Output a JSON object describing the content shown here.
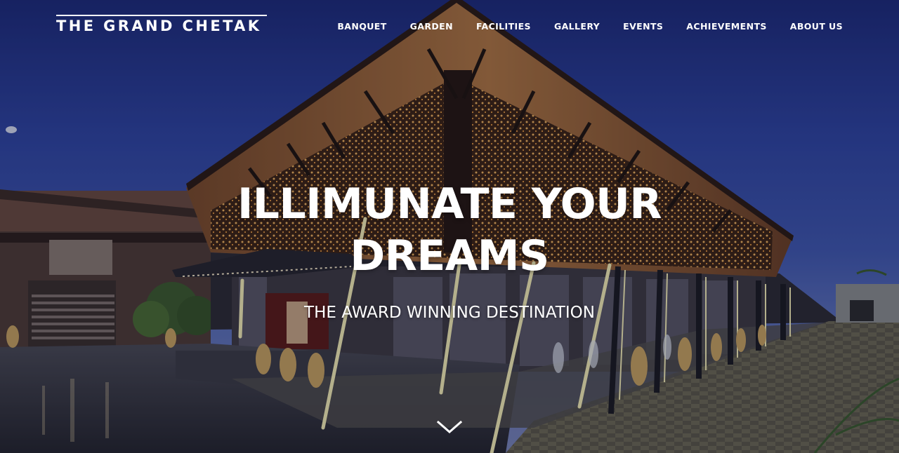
{
  "brand": {
    "logo_text": "THE GRAND CHETAK"
  },
  "nav": {
    "items": [
      {
        "label": "BANQUET"
      },
      {
        "label": "GARDEN"
      },
      {
        "label": "FACILITIES"
      },
      {
        "label": "GALLERY"
      },
      {
        "label": "EVENTS"
      },
      {
        "label": "ACHIEVEMENTS"
      },
      {
        "label": "ABOUT US"
      }
    ]
  },
  "hero": {
    "headline_line1": "ILLIMUNATE YOUR",
    "headline_line2": "DREAMS",
    "subheadline": "THE AWARD WINNING DESTINATION",
    "scroll_icon": "chevron-down-icon"
  },
  "colors": {
    "sky_top": "#1c2a78",
    "sky_mid": "#3f57ad",
    "warm_light": "#f2b35a",
    "text": "#ffffff"
  }
}
